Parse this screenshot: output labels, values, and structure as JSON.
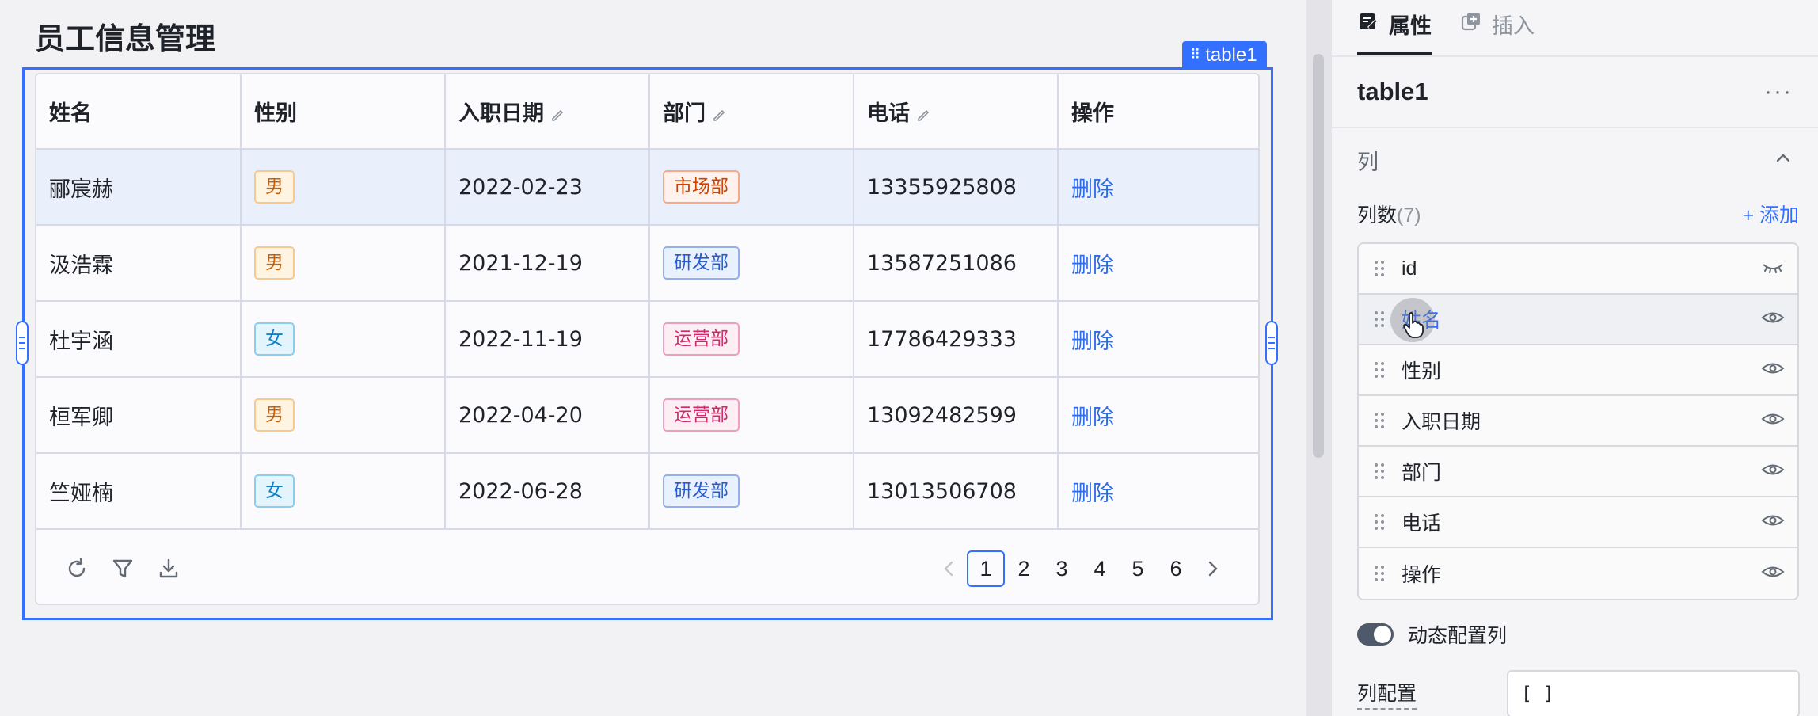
{
  "page": {
    "title": "员工信息管理"
  },
  "selection": {
    "component_label": "table1"
  },
  "table": {
    "columns": [
      {
        "label": "姓名",
        "editable": false
      },
      {
        "label": "性别",
        "editable": false
      },
      {
        "label": "入职日期",
        "editable": true
      },
      {
        "label": "部门",
        "editable": true
      },
      {
        "label": "电话",
        "editable": true
      },
      {
        "label": "操作",
        "editable": false
      }
    ],
    "rows": [
      {
        "name": "郦宸赫",
        "gender": "男",
        "gender_type": "male",
        "date": "2022-02-23",
        "dept": "市场部",
        "dept_type": "market",
        "phone": "13355925808",
        "action": "删除"
      },
      {
        "name": "汲浩霖",
        "gender": "男",
        "gender_type": "male",
        "date": "2021-12-19",
        "dept": "研发部",
        "dept_type": "rd",
        "phone": "13587251086",
        "action": "删除"
      },
      {
        "name": "杜宇涵",
        "gender": "女",
        "gender_type": "female",
        "date": "2022-11-19",
        "dept": "运营部",
        "dept_type": "ops",
        "phone": "17786429333",
        "action": "删除"
      },
      {
        "name": "桓军卿",
        "gender": "男",
        "gender_type": "male",
        "date": "2022-04-20",
        "dept": "运营部",
        "dept_type": "ops",
        "phone": "13092482599",
        "action": "删除"
      },
      {
        "name": "竺娅楠",
        "gender": "女",
        "gender_type": "female",
        "date": "2022-06-28",
        "dept": "研发部",
        "dept_type": "rd",
        "phone": "13013506708",
        "action": "删除"
      }
    ],
    "footer_icons": [
      "refresh-icon",
      "filter-icon",
      "download-icon"
    ],
    "pagination": {
      "pages": [
        "1",
        "2",
        "3",
        "4",
        "5",
        "6"
      ],
      "current": "1"
    }
  },
  "panel": {
    "tabs": [
      {
        "label": "属性",
        "icon": "properties-icon",
        "active": true
      },
      {
        "label": "插入",
        "icon": "insert-icon",
        "active": false
      }
    ],
    "component_name": "table1",
    "more": "···",
    "section_title": "列",
    "columns_count_label": "列数",
    "columns_count": "(7)",
    "add_label": "+ 添加",
    "column_items": [
      {
        "label": "id",
        "visible": false
      },
      {
        "label": "姓名",
        "visible": true,
        "hovered": true
      },
      {
        "label": "性别",
        "visible": true
      },
      {
        "label": "入职日期",
        "visible": true
      },
      {
        "label": "部门",
        "visible": true
      },
      {
        "label": "电话",
        "visible": true
      },
      {
        "label": "操作",
        "visible": true
      }
    ],
    "dynamic_toggle_label": "动态配置列",
    "dynamic_toggle_on": true,
    "config_label": "列配置",
    "config_value": "[ ]"
  },
  "colors": {
    "accent": "#3370ff",
    "link": "#2e6be6",
    "selected_row": "#eaf0fb"
  }
}
